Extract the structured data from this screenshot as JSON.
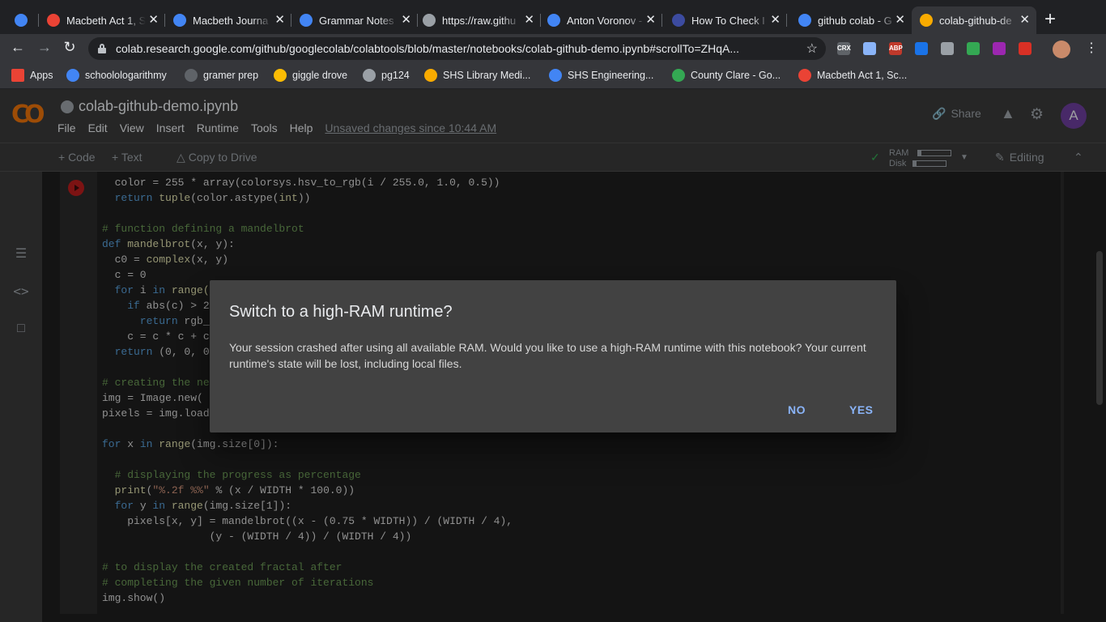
{
  "browser": {
    "tabs": [
      {
        "title": "",
        "icon": "s-circle-icon",
        "color": "#4285f4"
      },
      {
        "title": "Macbeth Act 1, S",
        "icon": "globe-icon",
        "color": "#ea4335"
      },
      {
        "title": "Macbeth Journa",
        "icon": "docs-icon",
        "color": "#4285f4"
      },
      {
        "title": "Grammar Notes",
        "icon": "docs-icon",
        "color": "#4285f4"
      },
      {
        "title": "https://raw.githu",
        "icon": "globe-icon",
        "color": "#9aa0a6"
      },
      {
        "title": "Anton Voronov -",
        "icon": "docs-icon",
        "color": "#4285f4"
      },
      {
        "title": "How To Check I",
        "icon": "bookmark-icon",
        "color": "#3c4ba0"
      },
      {
        "title": "github colab - G",
        "icon": "google-icon",
        "color": "#4285f4"
      },
      {
        "title": "colab-github-de",
        "icon": "colab-icon",
        "color": "#f9ab00"
      }
    ],
    "url": "colab.research.google.com/github/googlecolab/colabtools/blob/master/notebooks/colab-github-demo.ipynb#scrollTo=ZHqA...",
    "extensions": [
      {
        "label": "CRX",
        "color": "#5f6368"
      },
      {
        "label": "",
        "color": "#8ab4f8"
      },
      {
        "label": "ABP",
        "color": "#c0392b"
      },
      {
        "label": "",
        "color": "#1a73e8"
      },
      {
        "label": "",
        "color": "#9aa0a6"
      },
      {
        "label": "",
        "color": "#34a853"
      },
      {
        "label": "",
        "color": "#9c27b0"
      },
      {
        "label": "",
        "color": "#d93025"
      }
    ],
    "bookmarks": [
      {
        "label": "Apps",
        "icon": "apps-grid-icon",
        "color": "#ea4335"
      },
      {
        "label": "schoolologarithmy",
        "icon": "s-circle-icon",
        "color": "#4285f4"
      },
      {
        "label": "gramer prep",
        "icon": "gb-icon",
        "color": "#5f6368"
      },
      {
        "label": "giggle drove",
        "icon": "drive-icon",
        "color": "#fbbc04"
      },
      {
        "label": "pg124",
        "icon": "globe-icon",
        "color": "#9aa0a6"
      },
      {
        "label": "SHS Library Medi...",
        "icon": "library-icon",
        "color": "#f9ab00"
      },
      {
        "label": "SHS Engineering...",
        "icon": "s-circle-icon",
        "color": "#4285f4"
      },
      {
        "label": "County Clare - Go...",
        "icon": "maps-icon",
        "color": "#34a853"
      },
      {
        "label": "Macbeth Act 1, Sc...",
        "icon": "globe-icon",
        "color": "#ea4335"
      }
    ]
  },
  "colab": {
    "logo": "CO",
    "notebook_name": "colab-github-demo.ipynb",
    "menu": [
      "File",
      "Edit",
      "View",
      "Insert",
      "Runtime",
      "Tools",
      "Help"
    ],
    "unsaved": "Unsaved changes since 10:44 AM",
    "share_label": "Share",
    "avatar_letter": "A",
    "toolbar": {
      "code_label": "+ Code",
      "text_label": "+ Text",
      "copy_label": "Copy to Drive",
      "ram_label": "RAM",
      "disk_label": "Disk",
      "editing_label": "Editing"
    }
  },
  "code_lines": [
    {
      "segments": [
        {
          "t": "  color = 255 * array(colorsys.hsv_to_rgb(i / 255.0, 1.0, 0.5))",
          "c": ""
        }
      ]
    },
    {
      "segments": [
        {
          "t": "  return ",
          "c": "kw"
        },
        {
          "t": "tuple",
          "c": "fn"
        },
        {
          "t": "(color.astype(",
          "c": ""
        },
        {
          "t": "int",
          "c": "fn"
        },
        {
          "t": "))",
          "c": ""
        }
      ]
    },
    {
      "segments": [
        {
          "t": "",
          "c": ""
        }
      ]
    },
    {
      "segments": [
        {
          "t": "# function defining a mandelbrot",
          "c": "cm"
        }
      ]
    },
    {
      "segments": [
        {
          "t": "def ",
          "c": "kw"
        },
        {
          "t": "mandelbrot",
          "c": "fn"
        },
        {
          "t": "(x, y):",
          "c": ""
        }
      ]
    },
    {
      "segments": [
        {
          "t": "  c0 = ",
          "c": ""
        },
        {
          "t": "complex",
          "c": "fn"
        },
        {
          "t": "(x, y)",
          "c": ""
        }
      ]
    },
    {
      "segments": [
        {
          "t": "  c = 0",
          "c": ""
        }
      ]
    },
    {
      "segments": [
        {
          "t": "  for ",
          "c": "kw"
        },
        {
          "t": "i ",
          "c": ""
        },
        {
          "t": "in ",
          "c": "kw"
        },
        {
          "t": "range(",
          "c": "fn"
        }
      ]
    },
    {
      "segments": [
        {
          "t": "    if ",
          "c": "kw"
        },
        {
          "t": "abs(c) > 2",
          "c": ""
        }
      ]
    },
    {
      "segments": [
        {
          "t": "      return ",
          "c": "kw"
        },
        {
          "t": "rgb_",
          "c": ""
        }
      ]
    },
    {
      "segments": [
        {
          "t": "    c = c * c + c",
          "c": ""
        }
      ]
    },
    {
      "segments": [
        {
          "t": "  return ",
          "c": "kw"
        },
        {
          "t": "(0, 0, 0",
          "c": ""
        }
      ]
    },
    {
      "segments": [
        {
          "t": "",
          "c": ""
        }
      ]
    },
    {
      "segments": [
        {
          "t": "# creating the ne",
          "c": "cm"
        }
      ]
    },
    {
      "segments": [
        {
          "t": "img = Image.new(",
          "c": ""
        }
      ]
    },
    {
      "segments": [
        {
          "t": "pixels = img.load",
          "c": ""
        }
      ]
    },
    {
      "segments": [
        {
          "t": "",
          "c": ""
        }
      ]
    },
    {
      "segments": [
        {
          "t": "for ",
          "c": "kw"
        },
        {
          "t": "x ",
          "c": ""
        },
        {
          "t": "in ",
          "c": "kw"
        },
        {
          "t": "range",
          "c": "fn"
        },
        {
          "t": "(img.size[0]):",
          "c": ""
        }
      ]
    },
    {
      "segments": [
        {
          "t": "",
          "c": ""
        }
      ]
    },
    {
      "segments": [
        {
          "t": "  # displaying the progress as percentage",
          "c": "cm"
        }
      ]
    },
    {
      "segments": [
        {
          "t": "  print",
          "c": "fn"
        },
        {
          "t": "(",
          "c": ""
        },
        {
          "t": "\"%.2f %%\"",
          "c": "st"
        },
        {
          "t": " % (x / WIDTH * 100.0))",
          "c": ""
        }
      ]
    },
    {
      "segments": [
        {
          "t": "  for ",
          "c": "kw"
        },
        {
          "t": "y ",
          "c": ""
        },
        {
          "t": "in ",
          "c": "kw"
        },
        {
          "t": "range",
          "c": "fn"
        },
        {
          "t": "(img.size[1]):",
          "c": ""
        }
      ]
    },
    {
      "segments": [
        {
          "t": "    pixels[x, y] = mandelbrot((x - (0.75 * WIDTH)) / (WIDTH / 4),",
          "c": ""
        }
      ]
    },
    {
      "segments": [
        {
          "t": "                 (y - (WIDTH / 4)) / (WIDTH / 4))",
          "c": ""
        }
      ]
    },
    {
      "segments": [
        {
          "t": "",
          "c": ""
        }
      ]
    },
    {
      "segments": [
        {
          "t": "# to display the created fractal after",
          "c": "cm"
        }
      ]
    },
    {
      "segments": [
        {
          "t": "# completing the given number of iterations",
          "c": "cm"
        }
      ]
    },
    {
      "segments": [
        {
          "t": "img.show()",
          "c": ""
        }
      ]
    }
  ],
  "dialog": {
    "title": "Switch to a high-RAM runtime?",
    "body": "Your session crashed after using all available RAM. Would you like to use a high-RAM runtime with this notebook? Your current runtime's state will be lost, including local files.",
    "no_label": "NO",
    "yes_label": "YES"
  }
}
